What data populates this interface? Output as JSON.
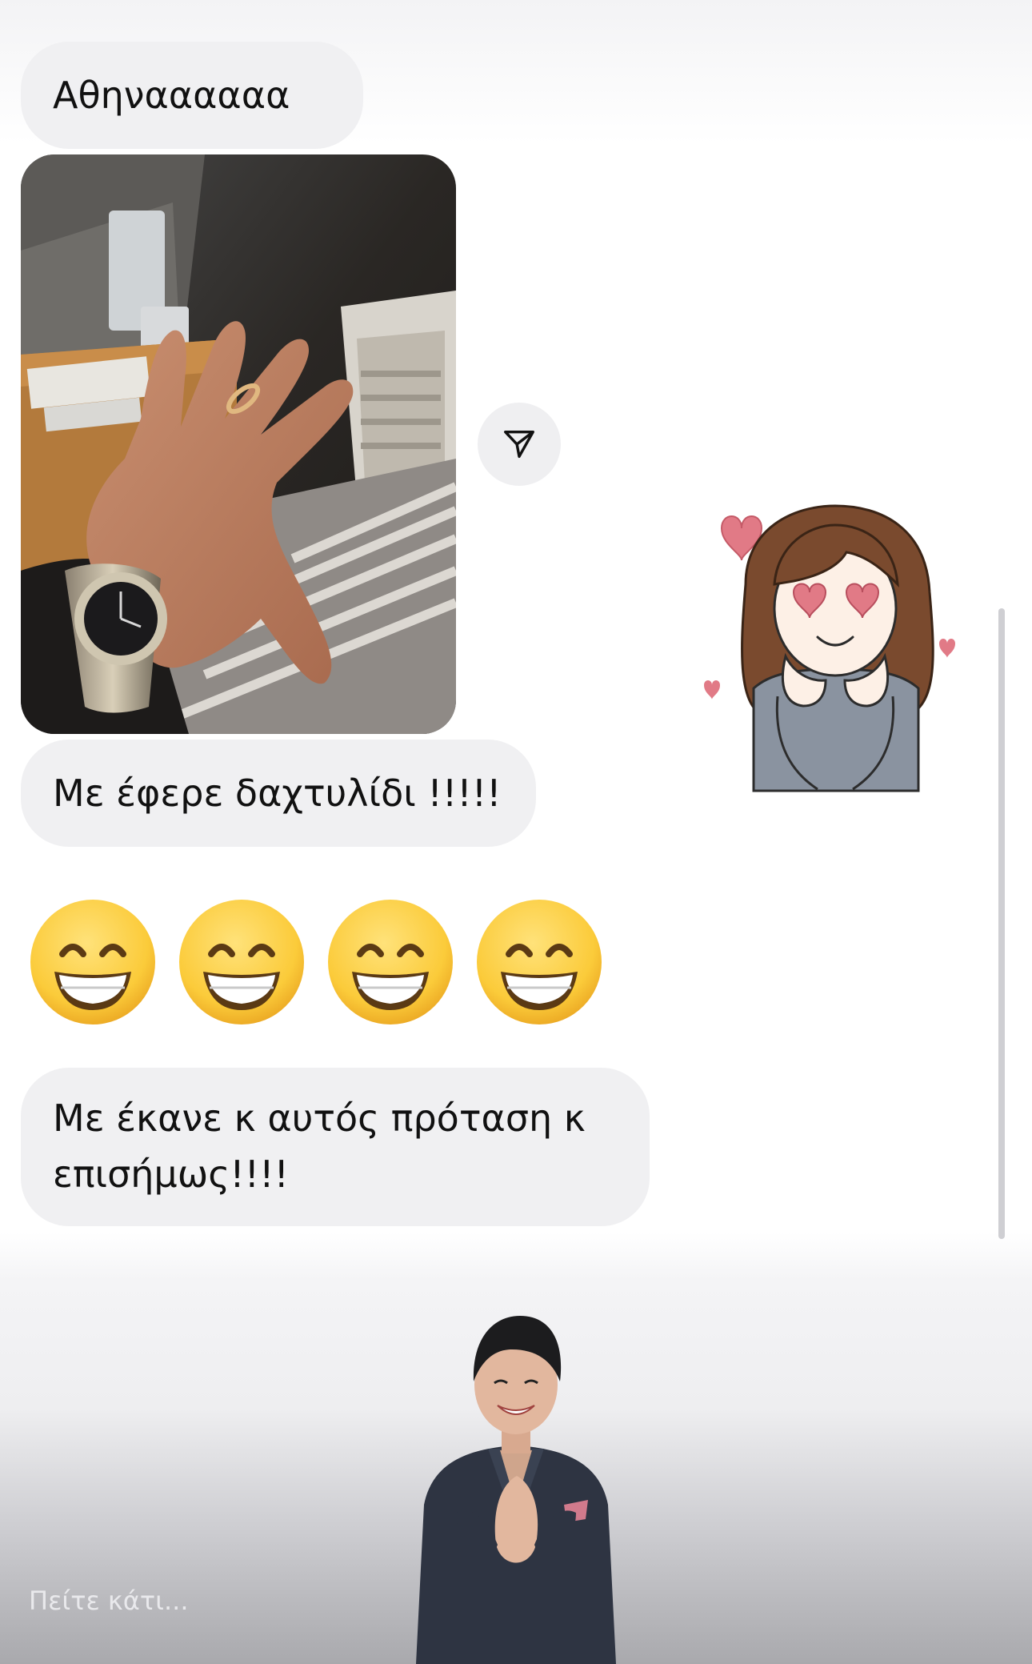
{
  "messages": [
    {
      "text": "Αθηναααααα ...."
    },
    {
      "text": "Με έφερε δαχτυλίδι !!!!!"
    },
    {
      "text": "Με έκανε κ αυτός πρόταση κ επισήμως!!!!"
    }
  ],
  "emoji_row": {
    "icon": "grinning-face-with-smiling-eyes-icon",
    "count": 4
  },
  "photo": {
    "subject": "hand-with-ring-and-watch"
  },
  "sticker": {
    "icon": "girl-heart-eyes-sticker"
  },
  "share_button": {
    "icon": "paper-plane-icon"
  },
  "overlay": {
    "presenter": "applauding-woman",
    "reply_placeholder": "Πείτε κάτι..."
  },
  "colors": {
    "bubble_bg": "#f0f0f2",
    "text": "#111111",
    "emoji_yellow": "#fbcb3a"
  }
}
